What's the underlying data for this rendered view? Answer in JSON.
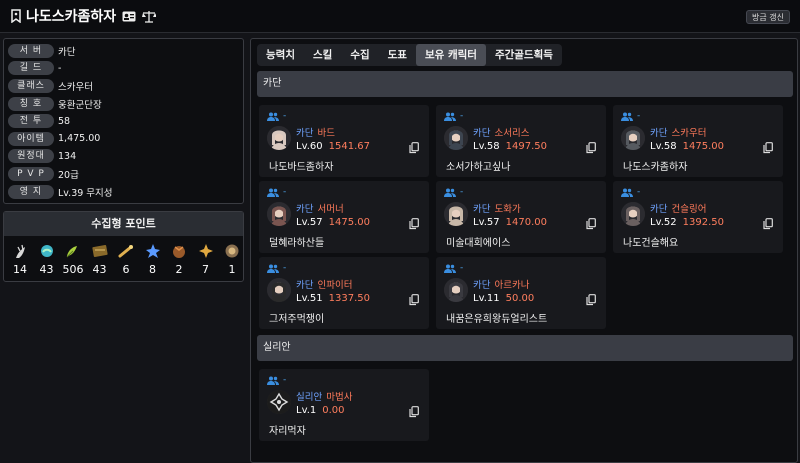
{
  "header": {
    "character_name": "나도스카좀하자",
    "refresh_label": "방금 갱신"
  },
  "info": [
    {
      "label": "서 버",
      "value": "카단"
    },
    {
      "label": "길 드",
      "value": "-"
    },
    {
      "label": "클래스",
      "value": "스카우터"
    },
    {
      "label": "칭 호",
      "value": "웅환군단장"
    },
    {
      "label": "전 투",
      "value": "58"
    },
    {
      "label": "아이템",
      "value": "1,475.00"
    },
    {
      "label": "원정대",
      "value": "134"
    },
    {
      "label": "P V P",
      "value": "20급"
    },
    {
      "label": "영 지",
      "value": "Lv.39 무지성"
    }
  ],
  "collection": {
    "title": "수집형 포인트",
    "items": [
      {
        "icon": "mokoko-seed-icon",
        "value": "14",
        "color": "#d8d8d8"
      },
      {
        "icon": "island-heart-icon",
        "value": "43",
        "color": "#5ad0c8"
      },
      {
        "icon": "worlds-tree-leaf-icon",
        "value": "506",
        "color": "#b9d84a"
      },
      {
        "icon": "orpheus-star-icon",
        "value": "43",
        "color": "#c9a44a"
      },
      {
        "icon": "giants-heart-icon",
        "value": "6",
        "color": "#d8b050"
      },
      {
        "icon": "great-art-icon",
        "value": "8",
        "color": "#6aa8ff"
      },
      {
        "icon": "ignea-token-icon",
        "value": "2",
        "color": "#c88a3a"
      },
      {
        "icon": "sea-bounty-icon",
        "value": "7",
        "color": "#e0a840"
      },
      {
        "icon": "omnium-star-icon",
        "value": "1",
        "color": "#c8a060"
      }
    ]
  },
  "tabs": [
    "능력치",
    "스킬",
    "수집",
    "도표",
    "보유 캐릭터",
    "주간골드획득"
  ],
  "active_tab": "보유 캐릭터",
  "groups": [
    {
      "server": "카단",
      "characters": [
        {
          "server": "카단",
          "class": "바드",
          "level": "Lv.60",
          "item_level": "1541.67",
          "name": "나도바드좀하자",
          "guild": "-"
        },
        {
          "server": "카단",
          "class": "소서리스",
          "level": "Lv.58",
          "item_level": "1497.50",
          "name": "소서가하고싶나",
          "guild": "-"
        },
        {
          "server": "카단",
          "class": "스카우터",
          "level": "Lv.58",
          "item_level": "1475.00",
          "name": "나도스카좀하자",
          "guild": "-"
        },
        {
          "server": "카단",
          "class": "서머너",
          "level": "Lv.57",
          "item_level": "1475.00",
          "name": "덜혜라하산들",
          "guild": "-"
        },
        {
          "server": "카단",
          "class": "도화가",
          "level": "Lv.57",
          "item_level": "1470.00",
          "name": "미술대회에이스",
          "guild": "-"
        },
        {
          "server": "카단",
          "class": "건슬링어",
          "level": "Lv.52",
          "item_level": "1392.50",
          "name": "나도건슬해요",
          "guild": "-"
        },
        {
          "server": "카단",
          "class": "인파이터",
          "level": "Lv.51",
          "item_level": "1337.50",
          "name": "그저주먹쟁이",
          "guild": "-"
        },
        {
          "server": "카단",
          "class": "아르카나",
          "level": "Lv.11",
          "item_level": "50.00",
          "name": "내꿈은유희왕듀얼리스트",
          "guild": "-"
        }
      ]
    },
    {
      "server": "실리안",
      "characters": [
        {
          "server": "실리안",
          "class": "마법사",
          "level": "Lv.1",
          "item_level": "0.00",
          "name": "자리먹자",
          "guild": "-"
        }
      ]
    }
  ]
}
